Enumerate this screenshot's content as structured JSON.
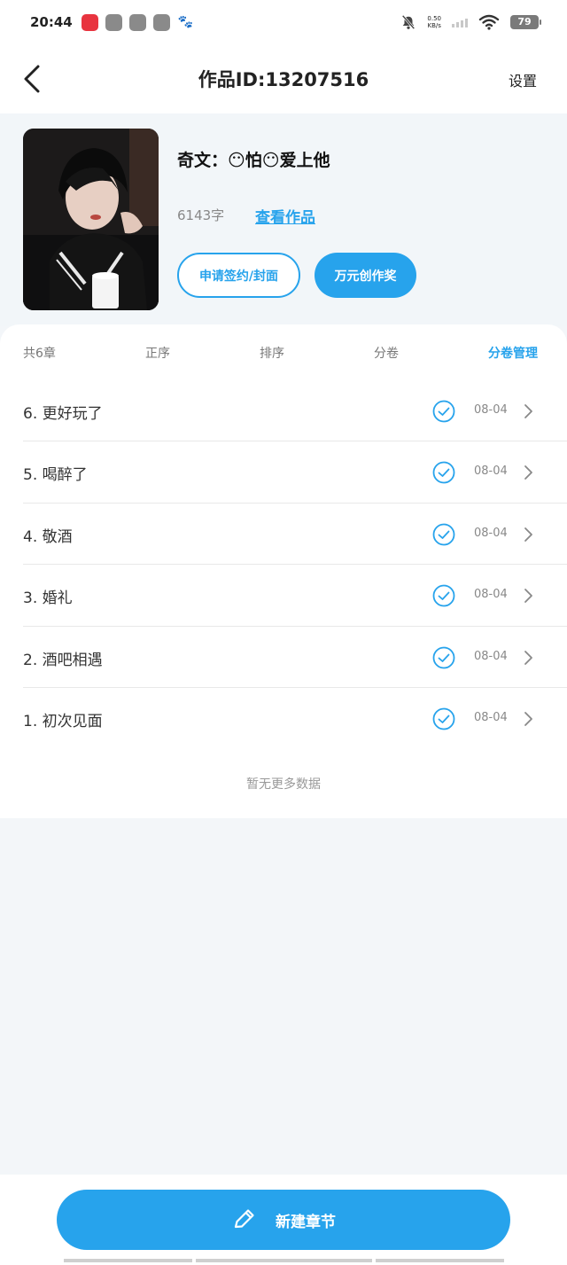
{
  "status_bar": {
    "time": "20:44",
    "net_speed_value": "0.50",
    "net_speed_unit": "KB/s",
    "battery": "79"
  },
  "header": {
    "title": "作品ID:13207516",
    "settings_label": "设置"
  },
  "work": {
    "title": "奇文：😶怕😶爱上他",
    "word_count": "6143字",
    "view_link": "查看作品",
    "sign_button": "申请签约/封面",
    "award_button": "万元创作奖"
  },
  "toolbar": {
    "count": "共6章",
    "order": "正序",
    "sort": "排序",
    "volume": "分卷",
    "manage": "分卷管理"
  },
  "chapters": [
    {
      "title": "6.  更好玩了",
      "date": "08-04"
    },
    {
      "title": "5.  喝醉了",
      "date": "08-04"
    },
    {
      "title": "4.  敬酒",
      "date": "08-04"
    },
    {
      "title": "3.  婚礼",
      "date": "08-04"
    },
    {
      "title": "2.  酒吧相遇",
      "date": "08-04"
    },
    {
      "title": "1.  初次见面",
      "date": "08-04"
    }
  ],
  "no_more": "暂无更多数据",
  "new_chapter_label": "新建章节",
  "colors": {
    "accent": "#27a3ec",
    "background": "#f3f6f9"
  }
}
